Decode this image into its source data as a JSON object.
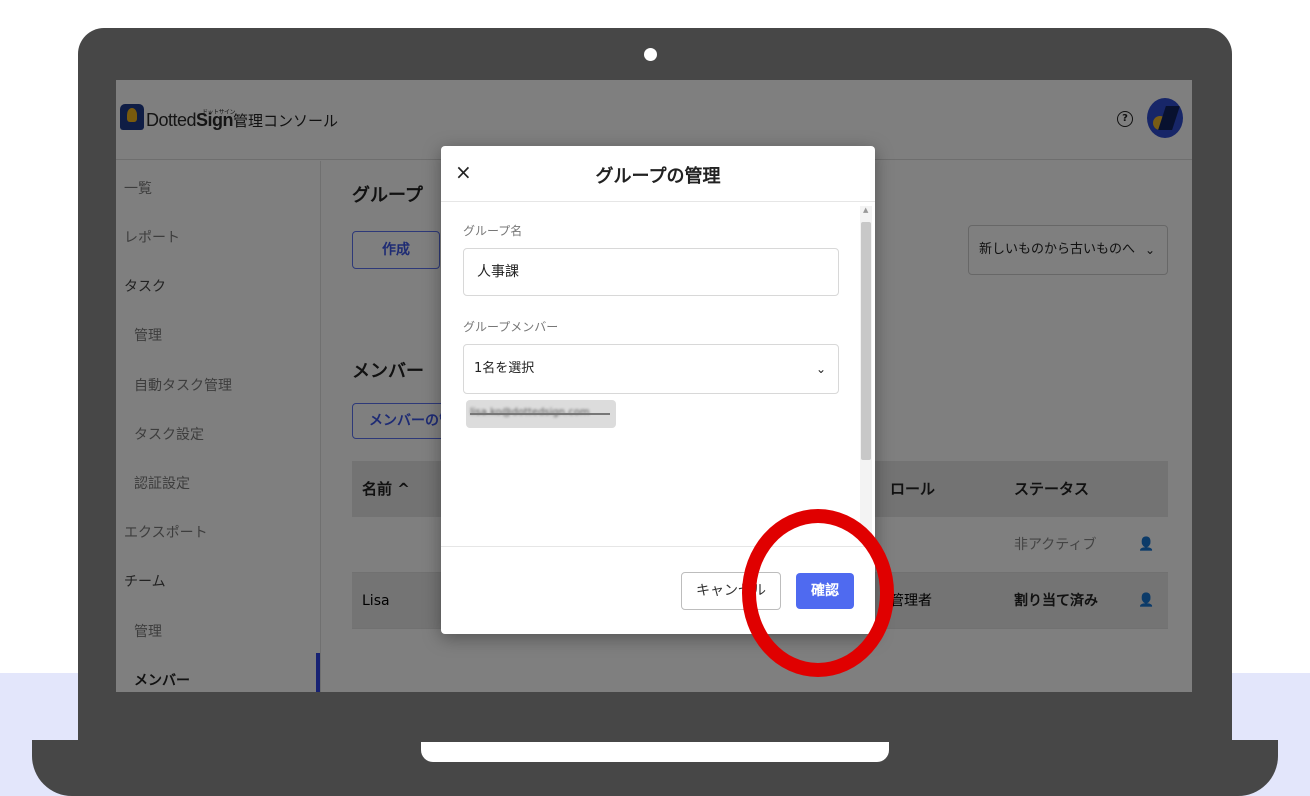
{
  "app": {
    "logo_kana": "ドットサイン",
    "logo_light": "Dotted",
    "logo_bold": "Sign",
    "console_title": "管理コンソール",
    "help_glyph": "?"
  },
  "sidebar": {
    "items": [
      {
        "label": "一覧"
      },
      {
        "label": "レポート"
      },
      {
        "label": "タスク"
      },
      {
        "label": "管理"
      },
      {
        "label": "自動タスク管理"
      },
      {
        "label": "タスク設定"
      },
      {
        "label": "認証設定"
      },
      {
        "label": "エクスポート"
      },
      {
        "label": "チーム"
      },
      {
        "label": "管理"
      },
      {
        "label": "メンバー"
      }
    ]
  },
  "main": {
    "group_heading": "グループ",
    "create_label": "作成",
    "sort_value": "新しいものから古いものへ",
    "member_heading": "メンバー",
    "member_mgmt_label": "メンバーの管理",
    "table": {
      "headers": {
        "name": "名前 ^",
        "role": "ロール",
        "status": "ステータス"
      },
      "rows": [
        {
          "name": "",
          "role": "",
          "status": "非アクティブ"
        },
        {
          "name": "Lisa",
          "role": "管理者",
          "status": "割り当て済み"
        }
      ]
    }
  },
  "modal": {
    "close_glyph": "×",
    "title": "グループの管理",
    "group_name_label": "グループ名",
    "group_name_value": "人事課",
    "group_member_label": "グループメンバー",
    "member_select_value": "1名を選択",
    "selected_member_email": "lisa.ko@dottedsign.com",
    "cancel_label": "キャンセル",
    "confirm_label": "確認"
  },
  "icons": {
    "chevron": "⌄",
    "person": "👤",
    "scroll_up": "▲"
  },
  "colors": {
    "accent": "#4f6af0",
    "highlight_ring": "#e00000",
    "laptop_frame": "#474747",
    "background_band": "#e3e6fb"
  }
}
